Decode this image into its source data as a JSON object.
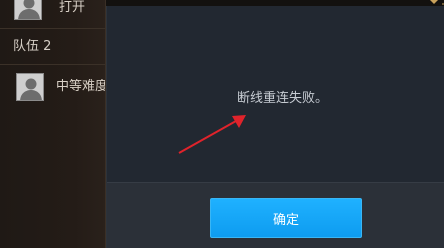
{
  "top_row": {
    "label": "打开"
  },
  "team": {
    "header": "队伍 2",
    "members": [
      {
        "name": "中等难度"
      }
    ]
  },
  "dialog": {
    "message": "断线重连失败。",
    "confirm_label": "确定"
  },
  "colors": {
    "accent": "#12a4f4",
    "dialog_bg": "#222831",
    "annotation": "#e0232b"
  },
  "icons": {
    "avatar": "default-avatar-icon",
    "dropdown": "dropdown-arrow-icon"
  }
}
